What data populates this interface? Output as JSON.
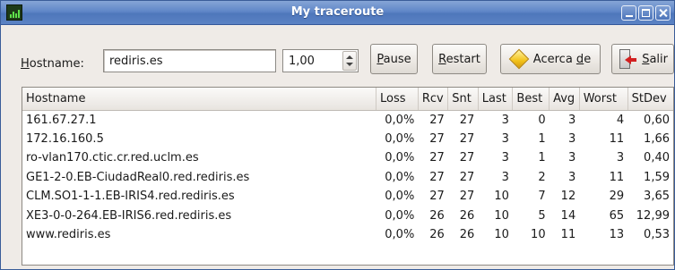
{
  "window": {
    "title": "My traceroute"
  },
  "toolbar": {
    "hostname_label_accel": "H",
    "hostname_label_rest": "ostname:",
    "hostname_value": "rediris.es",
    "interval_value": "1,00",
    "pause_accel": "P",
    "pause_rest": "ause",
    "restart_accel": "R",
    "restart_rest": "estart",
    "about_pre": "Acerca ",
    "about_accel": "d",
    "about_post": "e",
    "quit_accel": "S",
    "quit_rest": "alir"
  },
  "table": {
    "headers": [
      "Hostname",
      "Loss",
      "Rcv",
      "Snt",
      "Last",
      "Best",
      "Avg",
      "Worst",
      "StDev"
    ],
    "rows": [
      [
        "161.67.27.1",
        "0,0%",
        "27",
        "27",
        "3",
        "0",
        "3",
        "4",
        "0,60"
      ],
      [
        "172.16.160.5",
        "0,0%",
        "27",
        "27",
        "3",
        "1",
        "3",
        "11",
        "1,66"
      ],
      [
        "ro-vlan170.ctic.cr.red.uclm.es",
        "0,0%",
        "27",
        "27",
        "3",
        "1",
        "3",
        "3",
        "0,40"
      ],
      [
        "GE1-2-0.EB-CiudadReal0.red.rediris.es",
        "0,0%",
        "27",
        "27",
        "3",
        "2",
        "3",
        "11",
        "1,59"
      ],
      [
        "CLM.SO1-1-1.EB-IRIS4.red.rediris.es",
        "0,0%",
        "27",
        "27",
        "10",
        "7",
        "12",
        "29",
        "3,65"
      ],
      [
        "XE3-0-0-264.EB-IRIS6.red.rediris.es",
        "0,0%",
        "26",
        "26",
        "10",
        "5",
        "14",
        "65",
        "12,99"
      ],
      [
        "www.rediris.es",
        "0,0%",
        "26",
        "26",
        "10",
        "10",
        "11",
        "13",
        "0,53"
      ]
    ]
  },
  "icons": {
    "app": "terminal-icon",
    "about": "star-icon",
    "quit": "exit-door-icon"
  }
}
